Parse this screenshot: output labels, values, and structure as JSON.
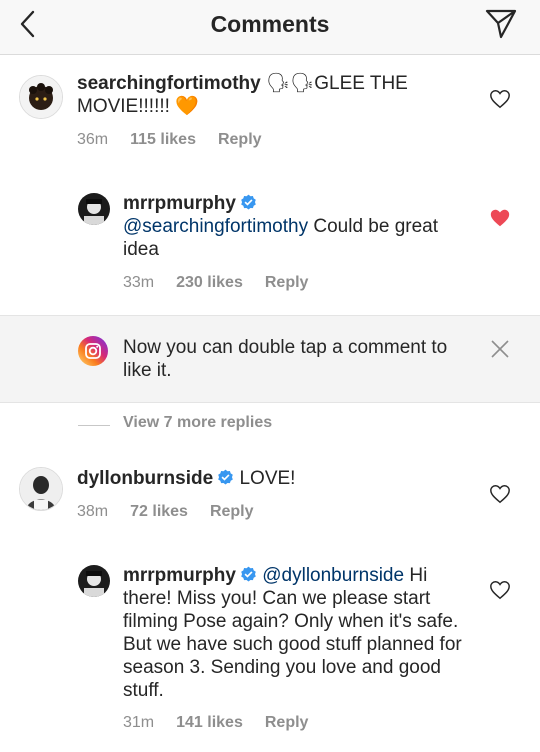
{
  "header": {
    "title": "Comments",
    "back_icon": "chevron-left-icon",
    "send_icon": "paper-plane-icon"
  },
  "comments": [
    {
      "username": "searchingfortimothy",
      "text": "🗣🗣GLEE THE MOVIE!!!!!! 🧡",
      "time": "36m",
      "likes": "115 likes",
      "reply": "Reply",
      "liked": false
    },
    {
      "username": "mrrpmurphy",
      "verified": true,
      "mention": "@searchingfortimothy",
      "text": " Could be great idea",
      "time": "33m",
      "likes": "230 likes",
      "reply": "Reply",
      "liked": true
    },
    {
      "username": "dyllonburnside",
      "verified": true,
      "text": "LOVE!",
      "time": "38m",
      "likes": "72 likes",
      "reply": "Reply",
      "liked": false
    },
    {
      "username": "mrrpmurphy",
      "verified": true,
      "mention": "@dyllonburnside",
      "text": " Hi there! Miss you! Can we please start filming Pose again? Only when it's safe. But we have such good stuff planned for season 3. Sending you love and good stuff.",
      "time": "31m",
      "likes": "141 likes",
      "reply": "Reply",
      "liked": false
    }
  ],
  "banner": {
    "text": "Now you can double tap a comment to like it.",
    "icon": "instagram-icon",
    "close_icon": "close-icon"
  },
  "view_more": "View 7 more replies",
  "colors": {
    "heart_liked": "#ed4956",
    "verified": "#3897f0",
    "mention": "#003569",
    "meta": "#8e8e8e"
  }
}
